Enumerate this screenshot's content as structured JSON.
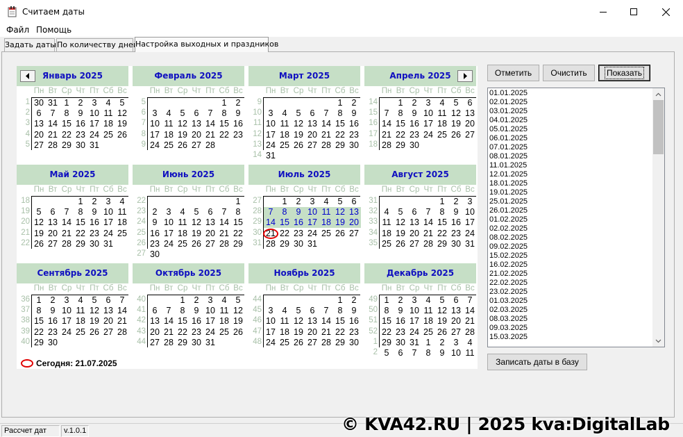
{
  "window": {
    "title": "Считаем даты",
    "minimize_icon": "minimize-icon",
    "maximize_icon": "maximize-icon",
    "close_icon": "close-icon"
  },
  "menu": [
    "Файл",
    "Помощь"
  ],
  "tabs": [
    {
      "label": "Задать даты",
      "active": false
    },
    {
      "label": "По количеству дней",
      "active": false
    },
    {
      "label": "Настройка выходных и праздников",
      "active": true
    }
  ],
  "calendar": {
    "weekdays": [
      "Пн",
      "Вт",
      "Ср",
      "Чт",
      "Пт",
      "Сб",
      "Вс"
    ],
    "today_label": "Сегодня: 21.07.2025",
    "today_date": "2025-07-21",
    "highlight_color": "#c6dfc6",
    "accent_color": "#1010c0",
    "today_ring_color": "#e00000",
    "months": [
      {
        "title": "Январь 2025",
        "weeks": [
          "1",
          "2",
          "3",
          "4",
          "5"
        ],
        "rows": [
          [
            "30",
            "31",
            "1",
            "2",
            "3",
            "4",
            "5"
          ],
          [
            "6",
            "7",
            "8",
            "9",
            "10",
            "11",
            "12"
          ],
          [
            "13",
            "14",
            "15",
            "16",
            "17",
            "18",
            "19"
          ],
          [
            "20",
            "21",
            "22",
            "23",
            "24",
            "25",
            "26"
          ],
          [
            "27",
            "28",
            "29",
            "30",
            "31",
            "",
            ""
          ]
        ]
      },
      {
        "title": "Февраль 2025",
        "weeks": [
          "5",
          "6",
          "7",
          "8",
          "9"
        ],
        "rows": [
          [
            "",
            "",
            "",
            "",
            "",
            "1",
            "2"
          ],
          [
            "3",
            "4",
            "5",
            "6",
            "7",
            "8",
            "9"
          ],
          [
            "10",
            "11",
            "12",
            "13",
            "14",
            "15",
            "16"
          ],
          [
            "17",
            "18",
            "19",
            "20",
            "21",
            "22",
            "23"
          ],
          [
            "24",
            "25",
            "26",
            "27",
            "28",
            "",
            ""
          ]
        ]
      },
      {
        "title": "Март 2025",
        "weeks": [
          "9",
          "10",
          "11",
          "12",
          "13",
          "14"
        ],
        "rows": [
          [
            "",
            "",
            "",
            "",
            "",
            "1",
            "2"
          ],
          [
            "3",
            "4",
            "5",
            "6",
            "7",
            "8",
            "9"
          ],
          [
            "10",
            "11",
            "12",
            "13",
            "14",
            "15",
            "16"
          ],
          [
            "17",
            "18",
            "19",
            "20",
            "21",
            "22",
            "23"
          ],
          [
            "24",
            "25",
            "26",
            "27",
            "28",
            "29",
            "30"
          ],
          [
            "31",
            "",
            "",
            "",
            "",
            "",
            ""
          ]
        ]
      },
      {
        "title": "Апрель 2025",
        "weeks": [
          "14",
          "15",
          "16",
          "17",
          "18"
        ],
        "rows": [
          [
            "",
            "1",
            "2",
            "3",
            "4",
            "5",
            "6"
          ],
          [
            "7",
            "8",
            "9",
            "10",
            "11",
            "12",
            "13"
          ],
          [
            "14",
            "15",
            "16",
            "17",
            "18",
            "19",
            "20"
          ],
          [
            "21",
            "22",
            "23",
            "24",
            "25",
            "26",
            "27"
          ],
          [
            "28",
            "29",
            "30",
            "",
            "",
            "",
            ""
          ]
        ]
      },
      {
        "title": "Май 2025",
        "weeks": [
          "18",
          "19",
          "20",
          "21",
          "22"
        ],
        "rows": [
          [
            "",
            "",
            "",
            "1",
            "2",
            "3",
            "4"
          ],
          [
            "5",
            "6",
            "7",
            "8",
            "9",
            "10",
            "11"
          ],
          [
            "12",
            "13",
            "14",
            "15",
            "16",
            "17",
            "18"
          ],
          [
            "19",
            "20",
            "21",
            "22",
            "23",
            "24",
            "25"
          ],
          [
            "26",
            "27",
            "28",
            "29",
            "30",
            "31",
            ""
          ]
        ]
      },
      {
        "title": "Июнь 2025",
        "weeks": [
          "22",
          "23",
          "24",
          "25",
          "26",
          "27"
        ],
        "rows": [
          [
            "",
            "",
            "",
            "",
            "",
            "",
            "1"
          ],
          [
            "2",
            "3",
            "4",
            "5",
            "6",
            "7",
            "8"
          ],
          [
            "9",
            "10",
            "11",
            "12",
            "13",
            "14",
            "15"
          ],
          [
            "16",
            "17",
            "18",
            "19",
            "20",
            "21",
            "22"
          ],
          [
            "23",
            "24",
            "25",
            "26",
            "27",
            "28",
            "29"
          ],
          [
            "30",
            "",
            "",
            "",
            "",
            "",
            ""
          ]
        ]
      },
      {
        "title": "Июль 2025",
        "weeks": [
          "27",
          "28",
          "29",
          "30",
          "31"
        ],
        "rows": [
          [
            "",
            "1",
            "2",
            "3",
            "4",
            "5",
            "6"
          ],
          [
            "7",
            "8",
            "9",
            "10",
            "11",
            "12",
            "13"
          ],
          [
            "14",
            "15",
            "16",
            "17",
            "18",
            "19",
            "20"
          ],
          [
            "21",
            "22",
            "23",
            "24",
            "25",
            "26",
            "27"
          ],
          [
            "28",
            "29",
            "30",
            "31",
            "",
            "",
            ""
          ]
        ],
        "highlighted": [
          "7",
          "8",
          "9",
          "10",
          "11",
          "12",
          "13",
          "14",
          "15",
          "16",
          "17",
          "18",
          "19",
          "20"
        ],
        "today": "21"
      },
      {
        "title": "Август 2025",
        "weeks": [
          "31",
          "32",
          "33",
          "34",
          "35"
        ],
        "rows": [
          [
            "",
            "",
            "",
            "",
            "1",
            "2",
            "3"
          ],
          [
            "4",
            "5",
            "6",
            "7",
            "8",
            "9",
            "10"
          ],
          [
            "11",
            "12",
            "13",
            "14",
            "15",
            "16",
            "17"
          ],
          [
            "18",
            "19",
            "20",
            "21",
            "22",
            "23",
            "24"
          ],
          [
            "25",
            "26",
            "27",
            "28",
            "29",
            "30",
            "31"
          ]
        ]
      },
      {
        "title": "Сентябрь 2025",
        "weeks": [
          "36",
          "37",
          "38",
          "39",
          "40"
        ],
        "rows": [
          [
            "1",
            "2",
            "3",
            "4",
            "5",
            "6",
            "7"
          ],
          [
            "8",
            "9",
            "10",
            "11",
            "12",
            "13",
            "14"
          ],
          [
            "15",
            "16",
            "17",
            "18",
            "19",
            "20",
            "21"
          ],
          [
            "22",
            "23",
            "24",
            "25",
            "26",
            "27",
            "28"
          ],
          [
            "29",
            "30",
            "",
            "",
            "",
            "",
            ""
          ]
        ]
      },
      {
        "title": "Октябрь 2025",
        "weeks": [
          "40",
          "41",
          "42",
          "43",
          "44"
        ],
        "rows": [
          [
            "",
            "",
            "1",
            "2",
            "3",
            "4",
            "5"
          ],
          [
            "6",
            "7",
            "8",
            "9",
            "10",
            "11",
            "12"
          ],
          [
            "13",
            "14",
            "15",
            "16",
            "17",
            "18",
            "19"
          ],
          [
            "20",
            "21",
            "22",
            "23",
            "24",
            "25",
            "26"
          ],
          [
            "27",
            "28",
            "29",
            "30",
            "31",
            "",
            ""
          ]
        ]
      },
      {
        "title": "Ноябрь 2025",
        "weeks": [
          "44",
          "45",
          "46",
          "47",
          "48"
        ],
        "rows": [
          [
            "",
            "",
            "",
            "",
            "",
            "1",
            "2"
          ],
          [
            "3",
            "4",
            "5",
            "6",
            "7",
            "8",
            "9"
          ],
          [
            "10",
            "11",
            "12",
            "13",
            "14",
            "15",
            "16"
          ],
          [
            "17",
            "18",
            "19",
            "20",
            "21",
            "22",
            "23"
          ],
          [
            "24",
            "25",
            "26",
            "27",
            "28",
            "29",
            "30"
          ]
        ]
      },
      {
        "title": "Декабрь 2025",
        "weeks": [
          "49",
          "50",
          "51",
          "52",
          "1",
          "2"
        ],
        "rows": [
          [
            "1",
            "2",
            "3",
            "4",
            "5",
            "6",
            "7"
          ],
          [
            "8",
            "9",
            "10",
            "11",
            "12",
            "13",
            "14"
          ],
          [
            "15",
            "16",
            "17",
            "18",
            "19",
            "20",
            "21"
          ],
          [
            "22",
            "23",
            "24",
            "25",
            "26",
            "27",
            "28"
          ],
          [
            "29",
            "30",
            "31",
            "1",
            "2",
            "3",
            "4"
          ],
          [
            "5",
            "6",
            "7",
            "8",
            "9",
            "10",
            "11"
          ]
        ]
      }
    ]
  },
  "buttons": {
    "mark": "Отметить",
    "clear": "Очистить",
    "show": "Показать",
    "save": "Записать даты в базу"
  },
  "dates_list": [
    "01.01.2025",
    "02.01.2025",
    "03.01.2025",
    "04.01.2025",
    "05.01.2025",
    "06.01.2025",
    "07.01.2025",
    "08.01.2025",
    "11.01.2025",
    "12.01.2025",
    "18.01.2025",
    "19.01.2025",
    "25.01.2025",
    "26.01.2025",
    "01.02.2025",
    "02.02.2025",
    "08.02.2025",
    "09.02.2025",
    "15.02.2025",
    "16.02.2025",
    "21.02.2025",
    "22.02.2025",
    "23.02.2025",
    "01.03.2025",
    "02.03.2025",
    "08.03.2025",
    "09.03.2025",
    "15.03.2025"
  ],
  "status": {
    "left": "Рассчет дат",
    "version": "v.1.0.1"
  },
  "watermark": "© KVA42.RU | 2025 kva:DigitalLab"
}
